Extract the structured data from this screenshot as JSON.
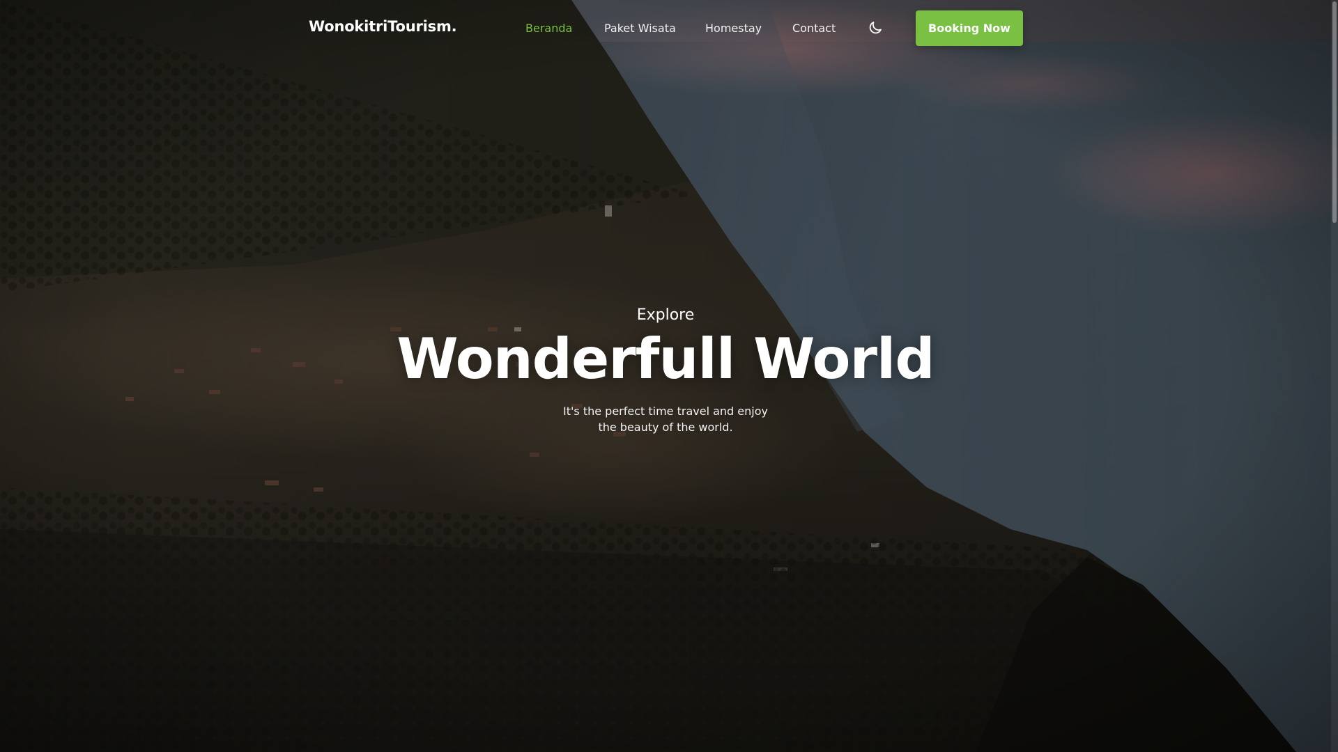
{
  "nav": {
    "brand": "WonokitriTourism.",
    "links": [
      "Beranda",
      "Paket Wisata",
      "Homestay",
      "Contact"
    ],
    "active_link": "Beranda",
    "theme_icon": "moon-icon",
    "cta_label": "Booking Now"
  },
  "hero": {
    "eyebrow": "Explore",
    "headline": "Wonderfull World",
    "subtext": "It's the perfect time travel and enjoy the beauty of the world.",
    "background": "aerial-mountain-village-fog-photo"
  },
  "colors": {
    "accent": "#7ac143",
    "text": "#ffffff",
    "fog": "#4e5e6b",
    "forest": "#221f19"
  }
}
